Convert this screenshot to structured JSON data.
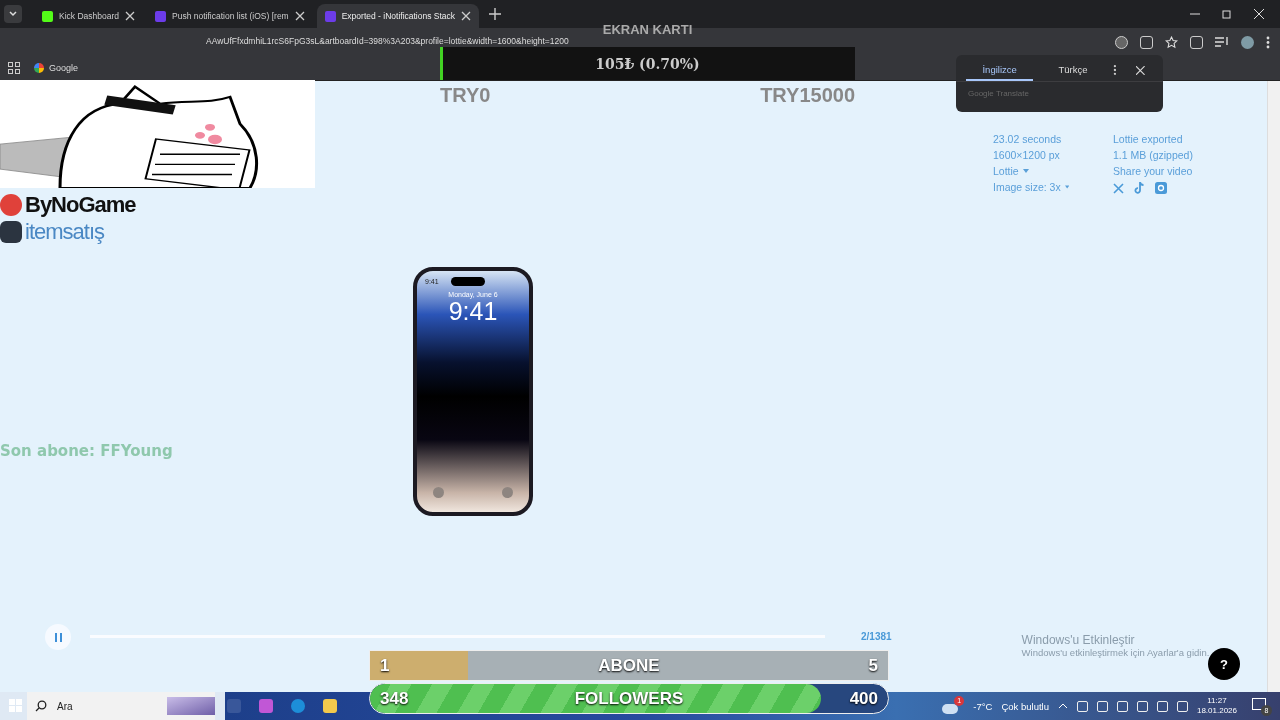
{
  "tabs": [
    {
      "title": "Kick Dashboard",
      "selected": false
    },
    {
      "title": "Push notification list (iOS) [rem",
      "selected": false
    },
    {
      "title": "Exported - iNotifications Stack",
      "selected": true
    }
  ],
  "address": "AAwUfFfxdmhiL1rcS6FpG3sL&artboardId=398%3A203&profile=lottie&width=1600&height=1200",
  "bookmarks": [
    "Google"
  ],
  "donation_goal": {
    "title": "EKRAN KARTI",
    "amount": "105₺ (0.70%)",
    "level": 0.007,
    "min": "TRY0",
    "max": "TRY15000"
  },
  "translate_popup": {
    "tabs": [
      {
        "label": "İngilizce",
        "selected": true
      },
      {
        "label": "Türkçe",
        "selected": false
      }
    ],
    "footer": "Google Translate"
  },
  "export_info": {
    "details": [
      {
        "text": "23.02 seconds",
        "dropdown": false
      },
      {
        "text": "1600×1200 px",
        "dropdown": false
      },
      {
        "text": "Lottie",
        "dropdown": true
      },
      {
        "text": "Image size: 3x",
        "dropdown": true
      }
    ],
    "status": [
      "Lottie exported",
      "1.1 MB (gzipped)"
    ],
    "share_label": "Share your video"
  },
  "phone": {
    "status_time": "9:41",
    "date": "Monday, June 6",
    "time": "9:41"
  },
  "sponsors": [
    "ByNoGame",
    "itemsatış"
  ],
  "last_subscriber": "Son abone: FFYoung",
  "player": {
    "playing": true,
    "frame": "2/1381"
  },
  "activation": {
    "title": "Windows'u Etkinleştir",
    "text": "Windows'u etkinleştirmek için Ayarlar'a gidin."
  },
  "help": "?",
  "goals": [
    {
      "kind": "flat",
      "current": "1",
      "label": "ABONE",
      "target": "5",
      "level": 0.19
    },
    {
      "kind": "striped",
      "current": "348",
      "label": "FOLLOWERS",
      "target": "400",
      "level": 0.87
    }
  ],
  "taskbar": {
    "search": "Ara",
    "weather_badge": "1",
    "temperature": "-7°C",
    "weather": "Çok bulutlu",
    "time": "11:27",
    "date": "18.01.2026",
    "notifications": "8"
  }
}
